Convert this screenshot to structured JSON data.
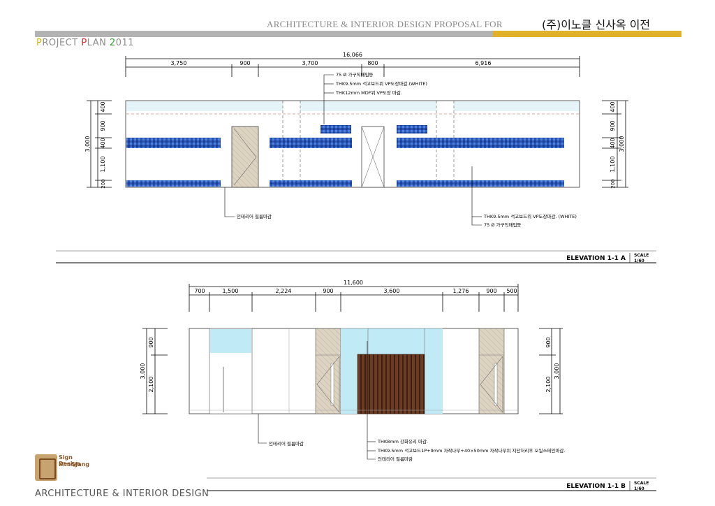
{
  "header": {
    "title": "ARCHITECTURE & INTERIOR DESIGN PROPOSAL FOR",
    "client": "(주)이노클 신사옥 이전",
    "project_p": "P",
    "project_roject": "ROJECT ",
    "project_plan_p": "P",
    "project_lan": "LAN ",
    "project_year_2": "2",
    "project_year_rest": "011",
    "colors": {
      "gray_bar": "#b3b3b3",
      "gold_bar": "#e0b129"
    }
  },
  "elevation_a": {
    "label": "ELEVATION 1-1 A",
    "scale_label": "SCALE",
    "scale_value": "1/60",
    "total_dim": "16,066",
    "dims": [
      "3,750",
      "900",
      "3,700",
      "800",
      "6,916"
    ],
    "left_dims": [
      "400",
      "900",
      "400",
      "1,100",
      "200"
    ],
    "left_total": "3,000",
    "right_dims": [
      "400",
      "900",
      "400",
      "1,100",
      "200"
    ],
    "right_total": "3,000",
    "notes_top": [
      "75 Ø 가구직매입등",
      "THK9.5mm 석고보드위 VP도장마감.(WHITE)",
      "THK12mm MDF위 VP도장 마감."
    ],
    "note_left": "인테리어 필름마감",
    "notes_right": [
      "THK9.5mm 석고보드위 VP도장마감. (WHITE)",
      "75 Ø 가구직매입등"
    ]
  },
  "elevation_b": {
    "label": "ELEVATION 1-1 B",
    "scale_label": "SCALE",
    "scale_value": "1/60",
    "total_dim": "11,600",
    "dims": [
      "700",
      "1,500",
      "2,224",
      "900",
      "3,600",
      "1,276",
      "900",
      "500"
    ],
    "left_dims": [
      "900",
      "2,100"
    ],
    "left_total": "3,000",
    "right_dims": [
      "900",
      "2,100"
    ],
    "right_total": "3,000",
    "note_left": "인테리어 필름마감",
    "notes_right": [
      "THK8mm 강화유리 마감.",
      "THK9.5mm 석고보드1P+9mm 자작나무+40×50mm 자작나무위 지단처리후 오일스테인마감.",
      "인테리어 필름마감"
    ]
  },
  "logo": {
    "line1": "Sign Design",
    "line2": "Kim&Jang"
  },
  "footer": {
    "text": "ARCHITECTURE & INTERIOR DESIGN"
  }
}
